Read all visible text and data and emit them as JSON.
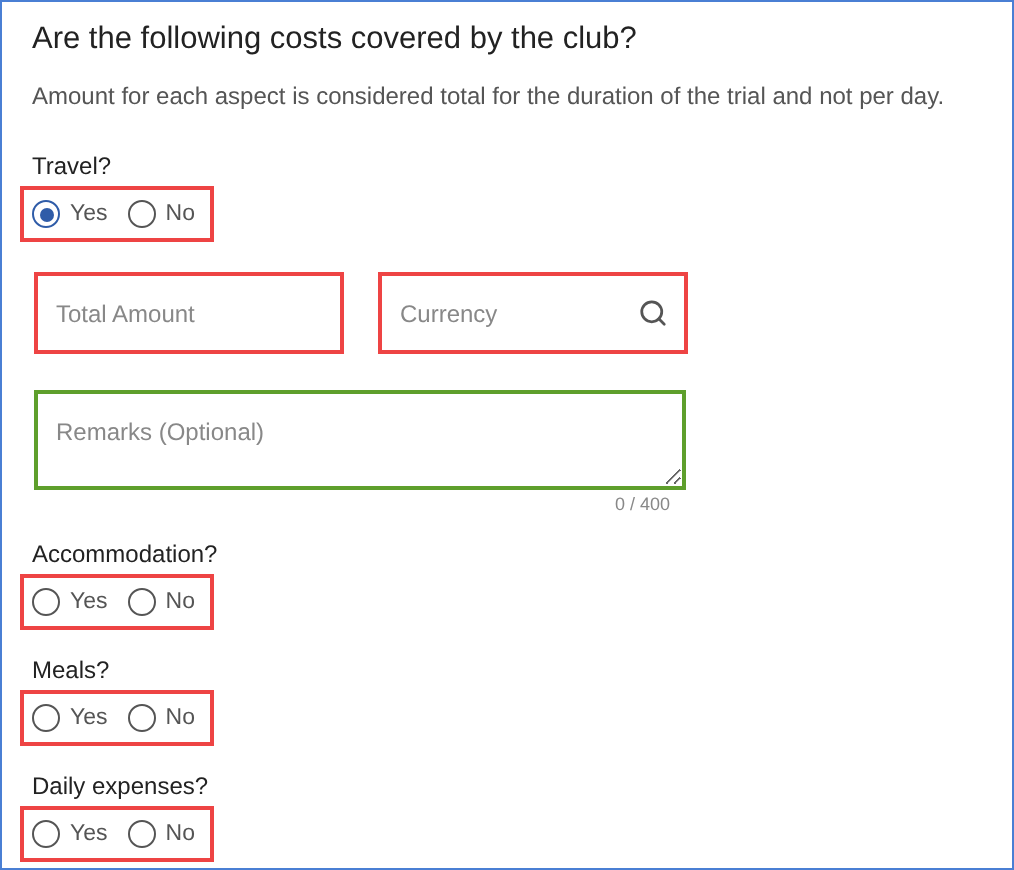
{
  "title": "Are the following costs covered by the club?",
  "note": "Amount for each aspect is considered total for the duration of the trial and not per day.",
  "blocks": [
    {
      "kind": "radio",
      "question": "Travel?",
      "color": "#ee4444",
      "options": [
        {
          "label": "Yes",
          "selected": true
        },
        {
          "label": "No",
          "selected": false
        }
      ]
    },
    {
      "kind": "fields",
      "fields": [
        {
          "placeholder": "Total Amount",
          "color": "#ee4444",
          "search": false
        },
        {
          "placeholder": "Currency",
          "color": "#ee4444",
          "search": true
        }
      ]
    },
    {
      "kind": "textarea",
      "placeholder": "Remarks (Optional)",
      "color": "#5e9f2c",
      "counter": "0 / 400"
    },
    {
      "kind": "radio",
      "question": "Accommodation?",
      "color": "#ee4444",
      "options": [
        {
          "label": "Yes",
          "selected": false
        },
        {
          "label": "No",
          "selected": false
        }
      ]
    },
    {
      "kind": "radio",
      "question": "Meals?",
      "color": "#ee4444",
      "options": [
        {
          "label": "Yes",
          "selected": false
        },
        {
          "label": "No",
          "selected": false
        }
      ]
    },
    {
      "kind": "radio",
      "question": "Daily expenses?",
      "color": "#ee4444",
      "options": [
        {
          "label": "Yes",
          "selected": false
        },
        {
          "label": "No",
          "selected": false
        }
      ]
    }
  ]
}
